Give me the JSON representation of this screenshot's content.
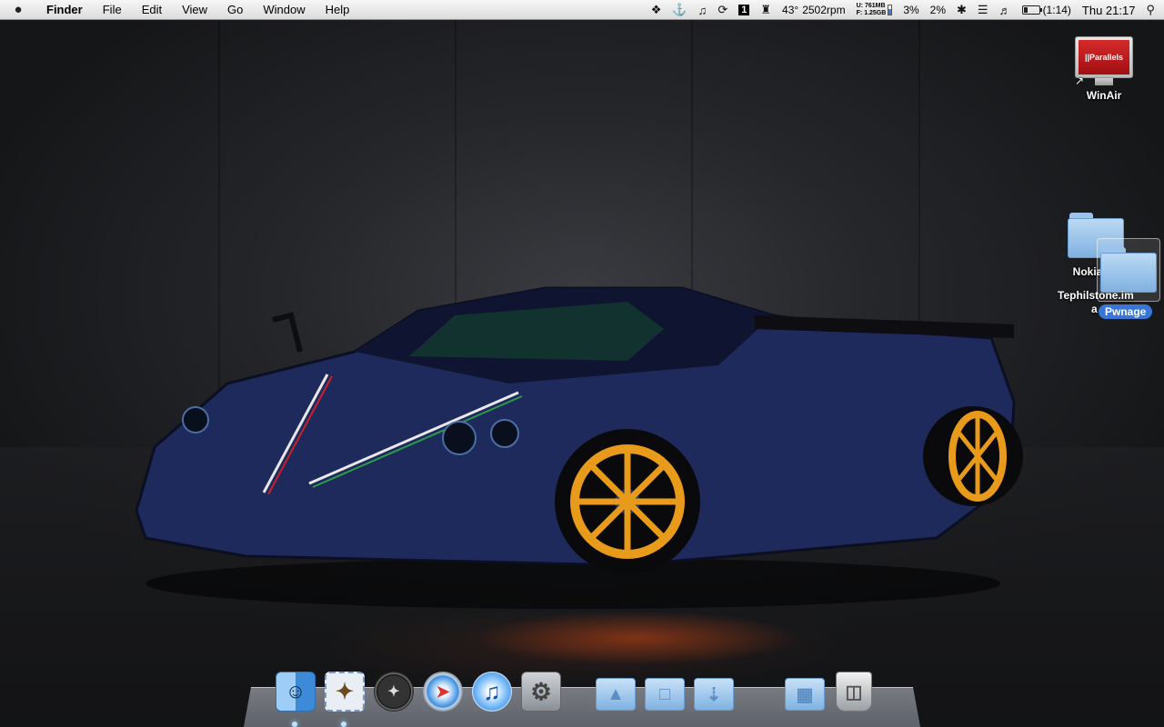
{
  "menubar": {
    "apple_icon": "apple-icon",
    "app_name": "Finder",
    "menus": [
      "File",
      "Edit",
      "View",
      "Go",
      "Window",
      "Help"
    ],
    "status": {
      "temperature": "43°",
      "fan_speed": "2502rpm",
      "mem_used_label": "U:",
      "mem_used": "761MB",
      "mem_free_label": "F:",
      "mem_free": "1.25GB",
      "disk_fill": 0.6,
      "cpu1": "3%",
      "cpu2": "2%",
      "battery_time": "(1:14)",
      "battery_level": 0.35,
      "clock": "Thu 21:17",
      "desktop_number": "1"
    }
  },
  "desktop": {
    "icons": [
      {
        "label": "WinAir",
        "badge": "||Parallels"
      },
      {
        "label": "NokiaSM"
      },
      {
        "label": "Pwnage"
      }
    ],
    "labels_overlap": [
      "Tephilstone.im",
      "a"
    ]
  },
  "dock": {
    "items": [
      {
        "name": "Finder",
        "icon": "finder-icon",
        "running": true
      },
      {
        "name": "Mail",
        "icon": "mail-icon",
        "running": true
      },
      {
        "name": "Dashboard",
        "icon": "dashboard-icon",
        "running": false
      },
      {
        "name": "Safari",
        "icon": "safari-icon",
        "running": false
      },
      {
        "name": "iTunes",
        "icon": "itunes-icon",
        "running": false
      },
      {
        "name": "System Preferences",
        "icon": "gear-icon",
        "running": false
      },
      {
        "name": "Applications",
        "icon": "applications-folder-icon",
        "running": false
      },
      {
        "name": "Documents",
        "icon": "documents-folder-icon",
        "running": false
      },
      {
        "name": "Downloads",
        "icon": "downloads-folder-icon",
        "running": false
      },
      {
        "name": "Windows",
        "icon": "windows-folder-icon",
        "running": false
      },
      {
        "name": "Trash",
        "icon": "trash-icon",
        "running": false
      }
    ]
  }
}
